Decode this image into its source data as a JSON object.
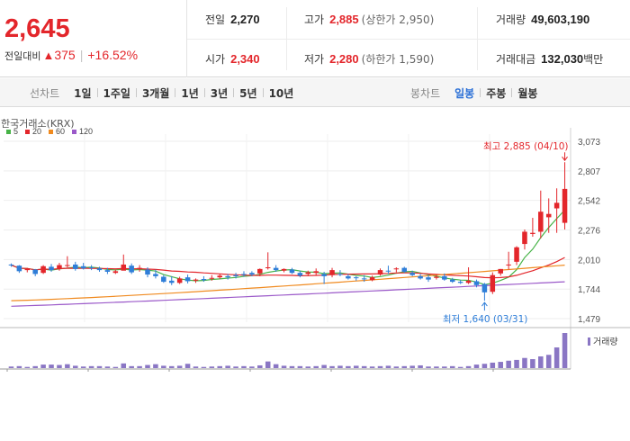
{
  "quote": {
    "price": "2,645",
    "change_label": "전일대비",
    "change_arrow": "▲",
    "change_value": "375",
    "change_pct": "+16.52%",
    "prev_close_label": "전일",
    "prev_close": "2,270",
    "open_label": "시가",
    "open": "2,340",
    "high_label": "고가",
    "high": "2,885",
    "upper_limit_label": "(상한가 2,950)",
    "low_label": "저가",
    "low": "2,280",
    "lower_limit_label": "(하한가 1,590)",
    "volume_label": "거래량",
    "volume": "49,603,190",
    "amount_label": "거래대금",
    "amount": "132,030",
    "amount_unit": "백만"
  },
  "toolbar": {
    "line_title": "선차트",
    "line_periods": [
      "1일",
      "1주일",
      "3개월",
      "1년",
      "3년",
      "5년",
      "10년"
    ],
    "candle_title": "봉차트",
    "candle_periods": [
      "일봉",
      "주봉",
      "월봉"
    ],
    "active_candle": "일봉"
  },
  "chart_data": {
    "type": "candlestick",
    "exchange": "한국거래소(KRX)",
    "ma_legend": [
      {
        "name": "5",
        "color": "#47b347"
      },
      {
        "name": "20",
        "color": "#e3262b"
      },
      {
        "name": "60",
        "color": "#f08a1f"
      },
      {
        "name": "120",
        "color": "#9b59c9"
      }
    ],
    "y_ticks": [
      3073,
      2807,
      2542,
      2276,
      2010,
      1744,
      1479
    ],
    "ylim": [
      1479,
      3073
    ],
    "colors": {
      "up": "#e3262b",
      "down": "#2f7ed8",
      "grid": "#eeeeee",
      "volume": "#8a76c4"
    },
    "high_annotation": "최고 2,885 (04/10)",
    "low_annotation": "최저 1,640 (03/31)",
    "volume_label": "거래량",
    "candles": [
      [
        1965,
        1975,
        1945,
        1960
      ],
      [
        1955,
        1960,
        1890,
        1905
      ],
      [
        1915,
        1935,
        1895,
        1925
      ],
      [
        1920,
        1925,
        1860,
        1880
      ],
      [
        1890,
        1960,
        1880,
        1950
      ],
      [
        1945,
        1970,
        1900,
        1915
      ],
      [
        1925,
        1980,
        1910,
        1960
      ],
      [
        1960,
        2040,
        1940,
        1960
      ],
      [
        1965,
        1990,
        1910,
        1925
      ],
      [
        1950,
        1980,
        1920,
        1930
      ],
      [
        1940,
        1960,
        1915,
        1935
      ],
      [
        1930,
        1945,
        1900,
        1915
      ],
      [
        1915,
        1935,
        1880,
        1900
      ],
      [
        1890,
        1920,
        1880,
        1905
      ],
      [
        1910,
        2055,
        1920,
        1965
      ],
      [
        1955,
        1975,
        1880,
        1895
      ],
      [
        1930,
        1960,
        1900,
        1935
      ],
      [
        1920,
        1940,
        1850,
        1875
      ],
      [
        1880,
        1920,
        1840,
        1860
      ],
      [
        1855,
        1870,
        1800,
        1810
      ],
      [
        1820,
        1860,
        1780,
        1800
      ],
      [
        1800,
        1855,
        1790,
        1840
      ],
      [
        1850,
        1875,
        1795,
        1815
      ],
      [
        1820,
        1840,
        1800,
        1830
      ],
      [
        1835,
        1860,
        1810,
        1825
      ],
      [
        1840,
        1870,
        1820,
        1845
      ],
      [
        1850,
        1880,
        1835,
        1865
      ],
      [
        1860,
        1880,
        1830,
        1850
      ],
      [
        1870,
        1890,
        1840,
        1860
      ],
      [
        1880,
        1905,
        1855,
        1875
      ],
      [
        1890,
        1905,
        1860,
        1875
      ],
      [
        1885,
        1930,
        1860,
        1925
      ],
      [
        1940,
        2075,
        1920,
        1940
      ],
      [
        1935,
        1960,
        1900,
        1915
      ],
      [
        1910,
        1930,
        1895,
        1925
      ],
      [
        1920,
        1935,
        1880,
        1890
      ],
      [
        1890,
        1910,
        1850,
        1865
      ],
      [
        1880,
        1910,
        1860,
        1895
      ],
      [
        1890,
        1930,
        1870,
        1905
      ],
      [
        1880,
        1900,
        1790,
        1860
      ],
      [
        1870,
        1935,
        1850,
        1915
      ],
      [
        1880,
        1915,
        1860,
        1875
      ],
      [
        1860,
        1880,
        1830,
        1840
      ],
      [
        1850,
        1860,
        1820,
        1845
      ],
      [
        1840,
        1870,
        1810,
        1835
      ],
      [
        1825,
        1865,
        1815,
        1850
      ],
      [
        1875,
        1930,
        1865,
        1915
      ],
      [
        1910,
        1955,
        1880,
        1905
      ],
      [
        1925,
        1940,
        1895,
        1930
      ],
      [
        1935,
        1945,
        1890,
        1900
      ],
      [
        1890,
        1910,
        1860,
        1870
      ],
      [
        1860,
        1880,
        1830,
        1840
      ],
      [
        1850,
        1870,
        1810,
        1830
      ],
      [
        1845,
        1880,
        1830,
        1855
      ],
      [
        1860,
        1885,
        1820,
        1830
      ],
      [
        1830,
        1845,
        1800,
        1810
      ],
      [
        1810,
        1825,
        1790,
        1800
      ],
      [
        1800,
        1940,
        1790,
        1820
      ],
      [
        1815,
        1830,
        1760,
        1780
      ],
      [
        1790,
        1800,
        1640,
        1715
      ],
      [
        1720,
        1895,
        1700,
        1870
      ],
      [
        1885,
        1925,
        1865,
        1925
      ],
      [
        1960,
        2080,
        1920,
        1965
      ],
      [
        1990,
        2130,
        1960,
        2120
      ],
      [
        2150,
        2280,
        2100,
        2260
      ],
      [
        2240,
        2385,
        2215,
        2250
      ],
      [
        2260,
        2630,
        2200,
        2440
      ],
      [
        2390,
        2560,
        2250,
        2420
      ],
      [
        2470,
        2650,
        2250,
        2520
      ],
      [
        2340,
        2885,
        2280,
        2645
      ]
    ],
    "volumes": [
      0.4,
      0.5,
      0.3,
      0.5,
      0.9,
      0.9,
      0.8,
      1.0,
      0.6,
      0.4,
      0.5,
      0.5,
      0.4,
      0.3,
      1.2,
      0.5,
      0.5,
      0.8,
      1.0,
      0.6,
      0.5,
      0.6,
      1.1,
      0.4,
      0.3,
      0.4,
      0.5,
      0.6,
      0.4,
      0.5,
      0.4,
      0.7,
      1.7,
      1.0,
      0.6,
      0.5,
      0.5,
      0.4,
      0.5,
      0.8,
      0.5,
      0.6,
      0.5,
      0.6,
      0.5,
      0.4,
      0.5,
      0.6,
      0.4,
      0.5,
      0.6,
      0.7,
      0.4,
      0.4,
      0.4,
      0.5,
      0.3,
      0.5,
      0.9,
      1.1,
      1.4,
      1.6,
      1.9,
      2.1,
      2.6,
      2.3,
      3.0,
      3.4,
      5.3,
      9.0
    ],
    "volume_max": 9.0
  }
}
